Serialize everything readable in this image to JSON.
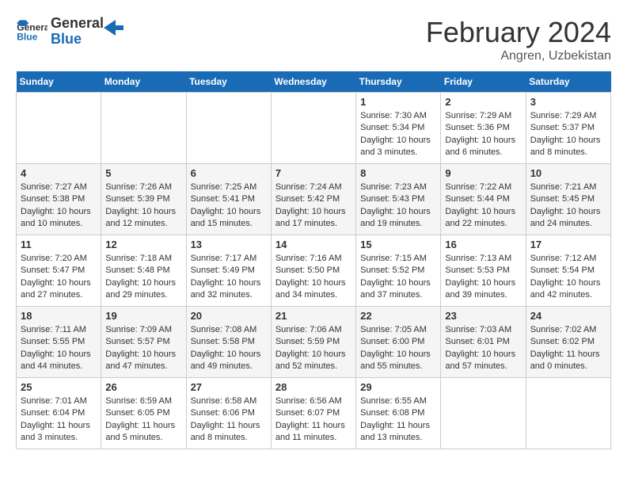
{
  "header": {
    "logo_general": "General",
    "logo_blue": "Blue",
    "month_title": "February 2024",
    "subtitle": "Angren, Uzbekistan"
  },
  "weekdays": [
    "Sunday",
    "Monday",
    "Tuesday",
    "Wednesday",
    "Thursday",
    "Friday",
    "Saturday"
  ],
  "weeks": [
    [
      {
        "day": "",
        "info": ""
      },
      {
        "day": "",
        "info": ""
      },
      {
        "day": "",
        "info": ""
      },
      {
        "day": "",
        "info": ""
      },
      {
        "day": "1",
        "info": "Sunrise: 7:30 AM\nSunset: 5:34 PM\nDaylight: 10 hours\nand 3 minutes."
      },
      {
        "day": "2",
        "info": "Sunrise: 7:29 AM\nSunset: 5:36 PM\nDaylight: 10 hours\nand 6 minutes."
      },
      {
        "day": "3",
        "info": "Sunrise: 7:29 AM\nSunset: 5:37 PM\nDaylight: 10 hours\nand 8 minutes."
      }
    ],
    [
      {
        "day": "4",
        "info": "Sunrise: 7:27 AM\nSunset: 5:38 PM\nDaylight: 10 hours\nand 10 minutes."
      },
      {
        "day": "5",
        "info": "Sunrise: 7:26 AM\nSunset: 5:39 PM\nDaylight: 10 hours\nand 12 minutes."
      },
      {
        "day": "6",
        "info": "Sunrise: 7:25 AM\nSunset: 5:41 PM\nDaylight: 10 hours\nand 15 minutes."
      },
      {
        "day": "7",
        "info": "Sunrise: 7:24 AM\nSunset: 5:42 PM\nDaylight: 10 hours\nand 17 minutes."
      },
      {
        "day": "8",
        "info": "Sunrise: 7:23 AM\nSunset: 5:43 PM\nDaylight: 10 hours\nand 19 minutes."
      },
      {
        "day": "9",
        "info": "Sunrise: 7:22 AM\nSunset: 5:44 PM\nDaylight: 10 hours\nand 22 minutes."
      },
      {
        "day": "10",
        "info": "Sunrise: 7:21 AM\nSunset: 5:45 PM\nDaylight: 10 hours\nand 24 minutes."
      }
    ],
    [
      {
        "day": "11",
        "info": "Sunrise: 7:20 AM\nSunset: 5:47 PM\nDaylight: 10 hours\nand 27 minutes."
      },
      {
        "day": "12",
        "info": "Sunrise: 7:18 AM\nSunset: 5:48 PM\nDaylight: 10 hours\nand 29 minutes."
      },
      {
        "day": "13",
        "info": "Sunrise: 7:17 AM\nSunset: 5:49 PM\nDaylight: 10 hours\nand 32 minutes."
      },
      {
        "day": "14",
        "info": "Sunrise: 7:16 AM\nSunset: 5:50 PM\nDaylight: 10 hours\nand 34 minutes."
      },
      {
        "day": "15",
        "info": "Sunrise: 7:15 AM\nSunset: 5:52 PM\nDaylight: 10 hours\nand 37 minutes."
      },
      {
        "day": "16",
        "info": "Sunrise: 7:13 AM\nSunset: 5:53 PM\nDaylight: 10 hours\nand 39 minutes."
      },
      {
        "day": "17",
        "info": "Sunrise: 7:12 AM\nSunset: 5:54 PM\nDaylight: 10 hours\nand 42 minutes."
      }
    ],
    [
      {
        "day": "18",
        "info": "Sunrise: 7:11 AM\nSunset: 5:55 PM\nDaylight: 10 hours\nand 44 minutes."
      },
      {
        "day": "19",
        "info": "Sunrise: 7:09 AM\nSunset: 5:57 PM\nDaylight: 10 hours\nand 47 minutes."
      },
      {
        "day": "20",
        "info": "Sunrise: 7:08 AM\nSunset: 5:58 PM\nDaylight: 10 hours\nand 49 minutes."
      },
      {
        "day": "21",
        "info": "Sunrise: 7:06 AM\nSunset: 5:59 PM\nDaylight: 10 hours\nand 52 minutes."
      },
      {
        "day": "22",
        "info": "Sunrise: 7:05 AM\nSunset: 6:00 PM\nDaylight: 10 hours\nand 55 minutes."
      },
      {
        "day": "23",
        "info": "Sunrise: 7:03 AM\nSunset: 6:01 PM\nDaylight: 10 hours\nand 57 minutes."
      },
      {
        "day": "24",
        "info": "Sunrise: 7:02 AM\nSunset: 6:02 PM\nDaylight: 11 hours\nand 0 minutes."
      }
    ],
    [
      {
        "day": "25",
        "info": "Sunrise: 7:01 AM\nSunset: 6:04 PM\nDaylight: 11 hours\nand 3 minutes."
      },
      {
        "day": "26",
        "info": "Sunrise: 6:59 AM\nSunset: 6:05 PM\nDaylight: 11 hours\nand 5 minutes."
      },
      {
        "day": "27",
        "info": "Sunrise: 6:58 AM\nSunset: 6:06 PM\nDaylight: 11 hours\nand 8 minutes."
      },
      {
        "day": "28",
        "info": "Sunrise: 6:56 AM\nSunset: 6:07 PM\nDaylight: 11 hours\nand 11 minutes."
      },
      {
        "day": "29",
        "info": "Sunrise: 6:55 AM\nSunset: 6:08 PM\nDaylight: 11 hours\nand 13 minutes."
      },
      {
        "day": "",
        "info": ""
      },
      {
        "day": "",
        "info": ""
      }
    ]
  ]
}
